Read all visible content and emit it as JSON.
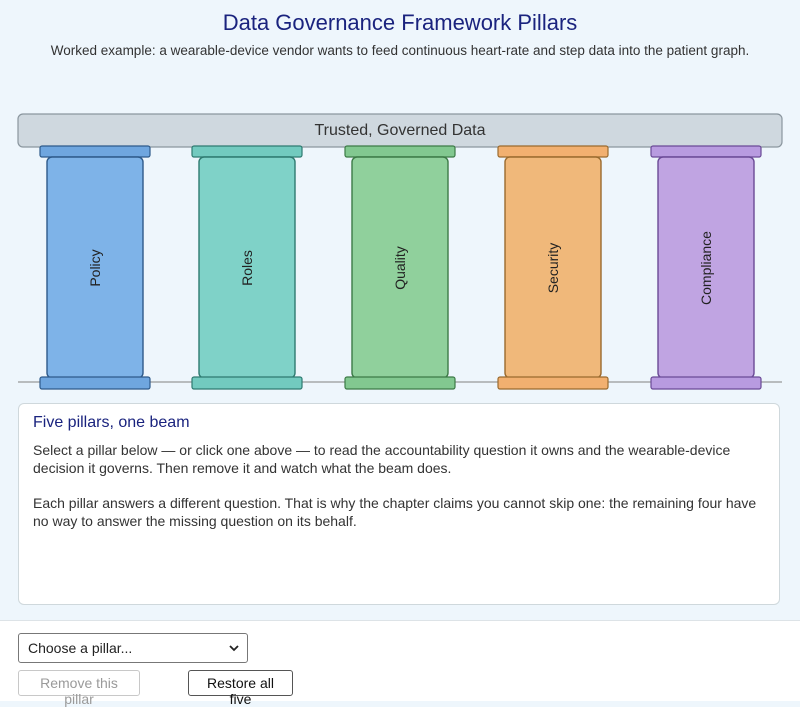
{
  "header": {
    "title": "Data Governance Framework Pillars",
    "subtitle": "Worked example: a wearable-device vendor wants to feed continuous heart-rate and step data into the patient graph."
  },
  "beam": {
    "label": "Trusted, Governed Data",
    "color": "#cfd8df"
  },
  "pillars": [
    {
      "label": "Policy",
      "color": "#7eb3e8",
      "cap": "#6fa6df",
      "stroke": "#2e5a8a"
    },
    {
      "label": "Roles",
      "color": "#7fd2c8",
      "cap": "#72cabf",
      "stroke": "#2e7a70"
    },
    {
      "label": "Quality",
      "color": "#90d09c",
      "cap": "#82c890",
      "stroke": "#3c7a46"
    },
    {
      "label": "Security",
      "color": "#f0b87a",
      "cap": "#f2b070",
      "stroke": "#9a6a2e"
    },
    {
      "label": "Compliance",
      "color": "#c0a4e2",
      "cap": "#b89be0",
      "stroke": "#6a4a96"
    }
  ],
  "panel": {
    "heading": "Five pillars, one beam",
    "para1": "Select a pillar below — or click one above — to read the accountability question it owns and the wearable-device decision it governs. Then remove it and watch what the beam does.",
    "para2": "Each pillar answers a different question. That is why the chapter claims you cannot skip one: the remaining four have no way to answer the missing question on its behalf."
  },
  "controls": {
    "select_value": "Choose a pillar...",
    "remove_label": "Remove this pillar",
    "restore_label": "Restore all five"
  }
}
